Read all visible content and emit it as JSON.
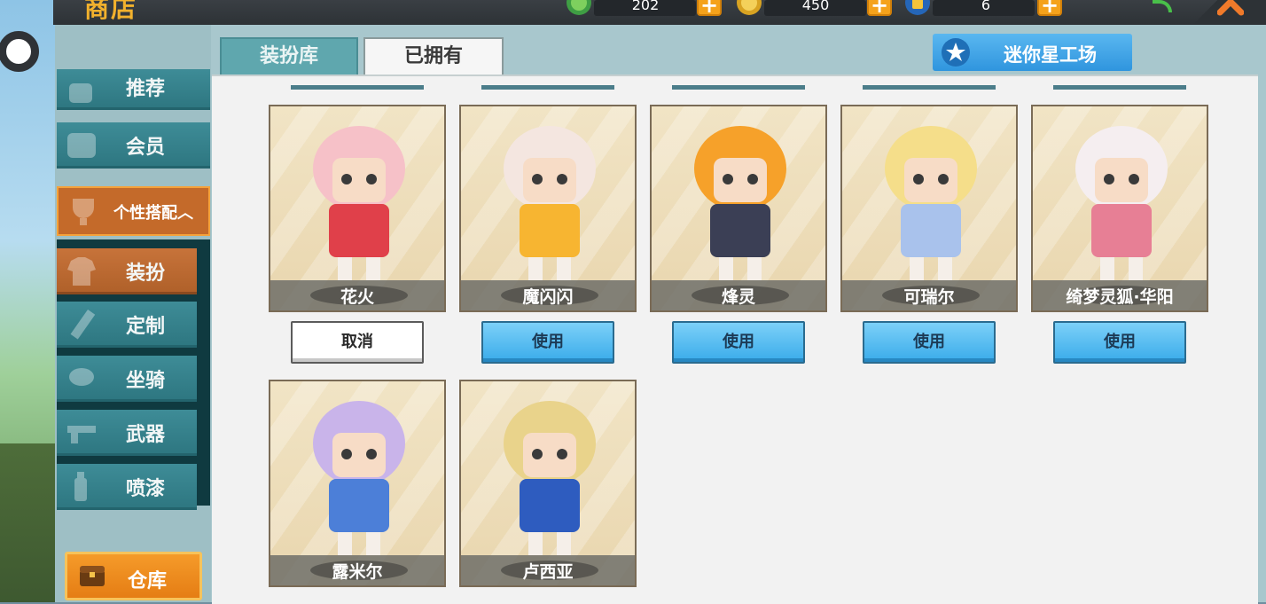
{
  "header": {
    "title": "商店",
    "currencies": [
      {
        "icon": "green-gem-icon",
        "value": "202",
        "color": "#4caf50"
      },
      {
        "icon": "gold-coin-icon",
        "value": "450",
        "color": "#e8b82a"
      },
      {
        "icon": "blue-ticket-icon",
        "value": "6",
        "color": "#2f7fd6"
      }
    ],
    "plus_label": "+",
    "close_icon": "close-icon",
    "signal_icon": "wifi-icon"
  },
  "tabs": [
    {
      "label": "装扮库",
      "active": true
    },
    {
      "label": "已拥有",
      "active": false
    }
  ],
  "factory_button": {
    "label": "迷你星工场",
    "icon": "star-icon"
  },
  "sidebar": {
    "items": [
      {
        "label": "推荐",
        "icon": "thumb-icon"
      },
      {
        "label": "会员",
        "icon": "member-icon"
      },
      {
        "label": "个性搭配︿",
        "icon": "trophy-icon"
      },
      {
        "label": "装扮",
        "icon": "shirt-icon",
        "active": true
      },
      {
        "label": "定制",
        "icon": "pencil-icon"
      },
      {
        "label": "坐骑",
        "icon": "saddle-icon"
      },
      {
        "label": "武器",
        "icon": "gun-icon"
      },
      {
        "label": "喷漆",
        "icon": "spray-icon"
      }
    ],
    "storage_label": "仓库",
    "storage_icon": "chest-icon"
  },
  "skins": [
    {
      "name": "花火",
      "action": "取消",
      "colors": [
        "#f6c1c8",
        "#e0404a"
      ]
    },
    {
      "name": "魔闪闪",
      "action": "使用",
      "colors": [
        "#f4e6e0",
        "#f7b531"
      ]
    },
    {
      "name": "烽灵",
      "action": "使用",
      "colors": [
        "#f6a12a",
        "#3b3f55"
      ]
    },
    {
      "name": "可瑞尔",
      "action": "使用",
      "colors": [
        "#f5de8a",
        "#a9c2ec"
      ]
    },
    {
      "name": "绮梦灵狐·华阳",
      "action": "使用",
      "colors": [
        "#f5eef0",
        "#e77f95"
      ]
    },
    {
      "name": "露米尔",
      "action": "",
      "colors": [
        "#c9b4ea",
        "#4c7fd8"
      ]
    },
    {
      "name": "卢西亚",
      "action": "",
      "colors": [
        "#e9d38b",
        "#2e5cbf"
      ]
    }
  ]
}
